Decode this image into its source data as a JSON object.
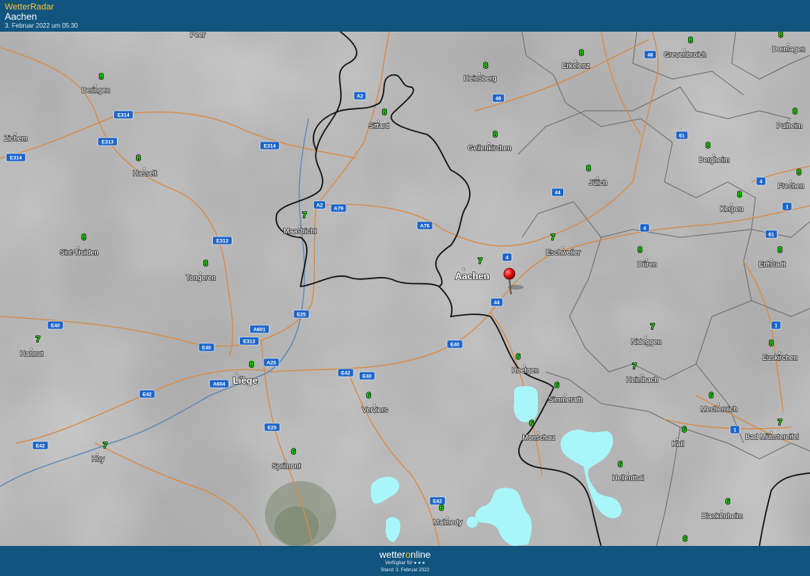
{
  "header": {
    "app_title": "WetterRadar",
    "location": "Aachen",
    "timestamp": "3. Februar 2022 um 05:30"
  },
  "footer": {
    "logo_prefix": "wetter",
    "logo_o": "o",
    "logo_suffix": "nline",
    "available_text": "Verfügbar für ● ● ●",
    "stand_text": "Stand: 3. Februar 2022"
  },
  "colors": {
    "header_bg": "#11557f",
    "temperature": "#19f000",
    "precipitation": "#a8f6fa",
    "roads": "#d98a45",
    "border": "#111111",
    "road_shield": "#1b64c8",
    "marker": "#e01010"
  },
  "marker": {
    "name": "location-pin-icon",
    "label": "Aachen"
  },
  "cities": [
    {
      "name": "Peer",
      "temp": ""
    },
    {
      "name": "Beringen",
      "temp": "8"
    },
    {
      "name": "Zichem",
      "temp": ""
    },
    {
      "name": "Hasselt",
      "temp": "8"
    },
    {
      "name": "Sint-Truiden",
      "temp": "8"
    },
    {
      "name": "Tongeren",
      "temp": "8"
    },
    {
      "name": "Hannut",
      "temp": "7"
    },
    {
      "name": "Huy",
      "temp": "7"
    },
    {
      "name": "Liège",
      "temp": "8"
    },
    {
      "name": "Sittard",
      "temp": "8"
    },
    {
      "name": "Maastricht",
      "temp": "7"
    },
    {
      "name": "Heinsberg",
      "temp": "8"
    },
    {
      "name": "Geilenkirchen",
      "temp": "8"
    },
    {
      "name": "Erkelenz",
      "temp": "8"
    },
    {
      "name": "Grevenbroich",
      "temp": "8"
    },
    {
      "name": "Dormagen",
      "temp": "8"
    },
    {
      "name": "Pulheim",
      "temp": "8"
    },
    {
      "name": "Bergheim",
      "temp": "8"
    },
    {
      "name": "Jülich",
      "temp": "8"
    },
    {
      "name": "Frechen",
      "temp": "8"
    },
    {
      "name": "Kerpen",
      "temp": "8"
    },
    {
      "name": "Eschweiler",
      "temp": "7"
    },
    {
      "name": "Aachen",
      "temp": "7"
    },
    {
      "name": "Düren",
      "temp": "8"
    },
    {
      "name": "Erftstadt",
      "temp": "8"
    },
    {
      "name": "Nideggen",
      "temp": "7"
    },
    {
      "name": "Euskirchen",
      "temp": "8"
    },
    {
      "name": "Roetgen",
      "temp": "6"
    },
    {
      "name": "Simmerath",
      "temp": "6"
    },
    {
      "name": "Heimbach",
      "temp": "7"
    },
    {
      "name": "Verviers",
      "temp": "6"
    },
    {
      "name": "Monschau",
      "temp": "6"
    },
    {
      "name": "Mechernich",
      "temp": "6"
    },
    {
      "name": "Bad Münstereifel",
      "temp": "7"
    },
    {
      "name": "Kall",
      "temp": "6"
    },
    {
      "name": "Hellenthal",
      "temp": "6"
    },
    {
      "name": "Sprimont",
      "temp": "6"
    },
    {
      "name": "Malmedy",
      "temp": "6"
    },
    {
      "name": "Blankenheim",
      "temp": "6"
    },
    {
      "name": "",
      "temp": "6"
    }
  ],
  "roads": [
    "E314",
    "E313",
    "E314",
    "E314",
    "A2",
    "A2",
    "A79",
    "A76",
    "46",
    "46",
    "61",
    "44",
    "4",
    "4",
    "1",
    "61",
    "4",
    "E313",
    "A601",
    "E313",
    "E25",
    "E40",
    "A25",
    "A604",
    "E42",
    "E40",
    "E42",
    "E40",
    "44",
    "E25",
    "E42",
    "E42",
    "1",
    "1",
    "E40"
  ]
}
